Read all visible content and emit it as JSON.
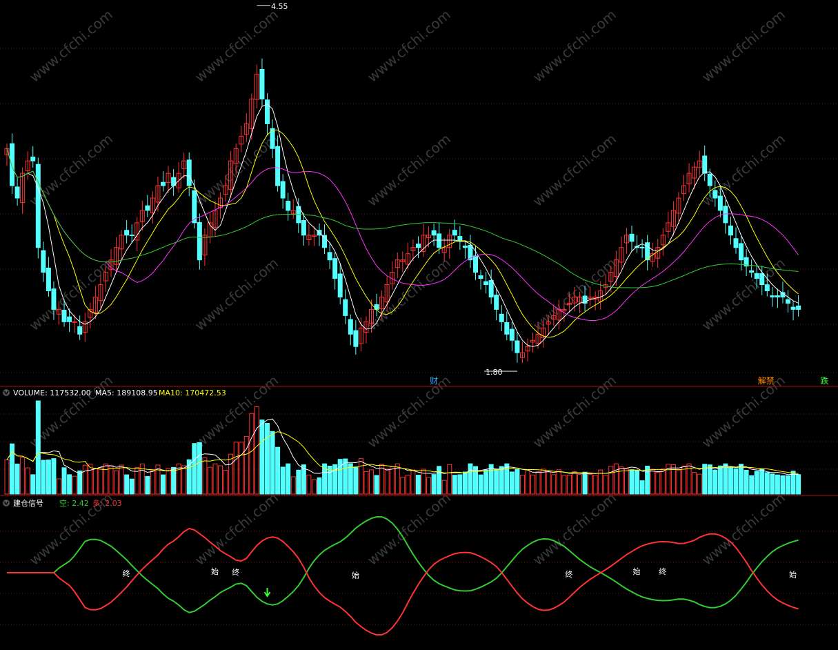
{
  "watermark": "www.cfchi.com",
  "price_panel": {
    "high_label": "4.55",
    "low_label": "1.80",
    "markers": [
      {
        "text": "财",
        "color": "#3aa0ff",
        "bar": 82
      },
      {
        "text": "解禁",
        "color": "#ff8c00",
        "bar": 145
      },
      {
        "text": "跌",
        "color": "#33ff33",
        "bar": 157
      }
    ]
  },
  "volume_panel": {
    "name": "VOLUME",
    "volume_label": "VOLUME: 117532.00",
    "ma5_label": "MA5: 189108.95",
    "ma10_label": "MA10: 170472.53",
    "colors": {
      "volume": "#ffffff",
      "ma5": "#ffffff",
      "ma10": "#ffff00"
    }
  },
  "signal_panel": {
    "name": "建仓信号",
    "empty_label": "空: 2.42",
    "long_label": "多: 2.03",
    "colors": {
      "empty": "#33cc33",
      "long": "#ff3333"
    },
    "events": [
      {
        "text": "终",
        "bar": 23
      },
      {
        "text": "始",
        "bar": 40
      },
      {
        "text": "终",
        "bar": 44
      },
      {
        "text": "始",
        "bar": 67
      },
      {
        "text": "终",
        "bar": 108
      },
      {
        "text": "始",
        "bar": 121
      },
      {
        "text": "终",
        "bar": 126
      },
      {
        "text": "始",
        "bar": 151
      }
    ],
    "arrow_bar": 50
  },
  "chart_data": {
    "type": "candlestick",
    "colors": {
      "up": "#ff3333",
      "down": "#54ffff",
      "ma5": "#ffffff",
      "ma10": "#ffff00",
      "ma20": "#ff33ff",
      "ma60": "#33cc33"
    },
    "close": [
      3.5,
      3.2,
      3.1,
      3.3,
      3.4,
      3.4,
      2.7,
      2.5,
      2.35,
      2.2,
      2.2,
      2.1,
      2.1,
      2.1,
      2.0,
      2.1,
      2.2,
      2.3,
      2.4,
      2.5,
      2.6,
      2.7,
      2.8,
      2.8,
      2.8,
      2.9,
      3.0,
      3.0,
      3.1,
      3.2,
      3.2,
      3.3,
      3.2,
      3.3,
      3.4,
      3.2,
      2.9,
      2.6,
      2.8,
      2.9,
      3.0,
      3.1,
      3.2,
      3.4,
      3.5,
      3.6,
      3.7,
      3.9,
      4.1,
      3.9,
      3.7,
      3.5,
      3.2,
      3.1,
      3.0,
      3.0,
      2.9,
      2.8,
      2.8,
      2.8,
      2.8,
      2.7,
      2.6,
      2.45,
      2.3,
      2.15,
      2.0,
      1.9,
      2.05,
      2.1,
      2.2,
      2.2,
      2.3,
      2.4,
      2.5,
      2.6,
      2.6,
      2.65,
      2.7,
      2.7,
      2.8,
      2.8,
      2.8,
      2.7,
      2.7,
      2.8,
      2.8,
      2.75,
      2.7,
      2.6,
      2.5,
      2.45,
      2.4,
      2.3,
      2.2,
      2.1,
      2.0,
      1.95,
      1.85,
      1.85,
      1.9,
      1.95,
      2.0,
      2.05,
      2.1,
      2.15,
      2.2,
      2.2,
      2.25,
      2.3,
      2.3,
      2.25,
      2.3,
      2.3,
      2.35,
      2.4,
      2.5,
      2.6,
      2.7,
      2.8,
      2.75,
      2.7,
      2.7,
      2.6,
      2.65,
      2.7,
      2.8,
      2.9,
      3.0,
      3.1,
      3.2,
      3.3,
      3.35,
      3.4,
      3.3,
      3.2,
      3.1,
      3.0,
      2.9,
      2.8,
      2.7,
      2.6,
      2.55,
      2.5,
      2.45,
      2.4,
      2.35,
      2.3,
      2.3,
      2.3,
      2.25,
      2.2,
      2.2
    ],
    "ma_note": "",
    "high_value": 4.55,
    "low_value": 1.8
  }
}
